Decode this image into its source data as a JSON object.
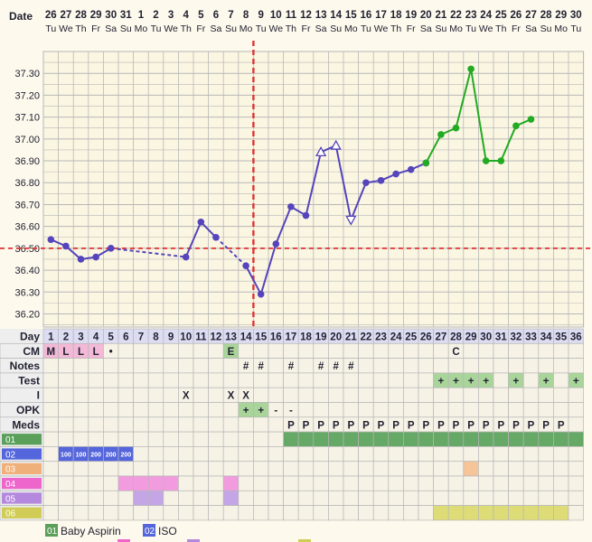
{
  "chart_data": {
    "type": "line",
    "title": "",
    "xlabel": "Day",
    "ylabel": "",
    "ylim": [
      36.14,
      37.4
    ],
    "yticks": [
      "37.30",
      "37.20",
      "37.10",
      "37.00",
      "36.90",
      "36.80",
      "36.70",
      "36.60",
      "36.50",
      "36.40",
      "36.30",
      "36.20"
    ],
    "date_label": "Date",
    "dates": [
      "26",
      "27",
      "28",
      "29",
      "30",
      "31",
      "1",
      "2",
      "3",
      "4",
      "5",
      "6",
      "7",
      "8",
      "9",
      "10",
      "11",
      "12",
      "13",
      "14",
      "15",
      "16",
      "17",
      "18",
      "19",
      "20",
      "21",
      "22",
      "23",
      "24",
      "25",
      "26",
      "27",
      "28",
      "29",
      "30"
    ],
    "weekdays": [
      "Tu",
      "We",
      "Th",
      "Fr",
      "Sa",
      "Su",
      "Mo",
      "Tu",
      "We",
      "Th",
      "Fr",
      "Sa",
      "Su",
      "Mo",
      "Tu",
      "We",
      "Th",
      "Fr",
      "Sa",
      "Su",
      "Mo",
      "Tu",
      "We",
      "Th",
      "Fr",
      "Sa",
      "Su",
      "Mo",
      "Tu",
      "We",
      "Th",
      "Fr",
      "Sa",
      "Su",
      "Mo",
      "Tu"
    ],
    "days": [
      1,
      2,
      3,
      4,
      5,
      6,
      7,
      8,
      9,
      10,
      11,
      12,
      13,
      14,
      15,
      16,
      17,
      18,
      19,
      20,
      21,
      22,
      23,
      24,
      25,
      26,
      27,
      28,
      29,
      30,
      31,
      32,
      33,
      34,
      35,
      36
    ],
    "coverline": 36.5,
    "ovulation_day": 15,
    "series": [
      {
        "name": "",
        "color": "#5544bb",
        "points": [
          [
            1,
            36.54
          ],
          [
            2,
            36.51
          ],
          [
            3,
            36.45
          ],
          [
            4,
            36.46
          ],
          [
            5,
            36.5
          ],
          [
            10,
            36.46
          ],
          [
            11,
            36.62
          ],
          [
            12,
            36.55
          ],
          [
            14,
            36.42
          ],
          [
            15,
            36.29
          ],
          [
            16,
            36.52
          ],
          [
            17,
            36.69
          ],
          [
            18,
            36.65
          ],
          [
            19,
            36.94
          ],
          [
            20,
            36.97
          ],
          [
            21,
            36.63
          ],
          [
            22,
            36.8
          ],
          [
            23,
            36.81
          ],
          [
            24,
            36.84
          ],
          [
            25,
            36.86
          ],
          [
            26,
            36.89
          ]
        ],
        "open_markers": [
          19,
          20,
          21
        ],
        "dashed_after": [
          5,
          12,
          14
        ]
      },
      {
        "name": "",
        "color": "#22aa22",
        "points": [
          [
            26,
            36.89
          ],
          [
            27,
            37.02
          ],
          [
            28,
            37.05
          ],
          [
            29,
            37.32
          ],
          [
            30,
            36.9
          ],
          [
            31,
            36.9
          ],
          [
            32,
            37.06
          ],
          [
            33,
            37.09
          ]
        ]
      }
    ],
    "rows": [
      {
        "label": "CM",
        "cells": {
          "1": "M",
          "2": "L",
          "3": "L",
          "4": "L",
          "5": "•",
          "13": "E",
          "28": "C"
        },
        "fills": {
          "1": "#f3b9d6",
          "2": "#f3b9d6",
          "3": "#f3b9d6",
          "4": "#f3b9d6",
          "13": "#a9d59a"
        }
      },
      {
        "label": "Notes",
        "cells": {
          "14": "#",
          "15": "#",
          "17": "#",
          "19": "#",
          "20": "#",
          "21": "#"
        },
        "fills": {}
      },
      {
        "label": "Test",
        "cells": {
          "27": "+",
          "28": "+",
          "29": "+",
          "30": "+",
          "32": "+",
          "34": "+",
          "36": "+"
        },
        "fills": {
          "27": "#a9d59a",
          "28": "#a9d59a",
          "29": "#a9d59a",
          "30": "#a9d59a",
          "32": "#a9d59a",
          "34": "#a9d59a",
          "36": "#a9d59a"
        }
      },
      {
        "label": "I",
        "cells": {
          "10": "X",
          "13": "X",
          "14": "X"
        },
        "fills": {}
      },
      {
        "label": "OPK",
        "cells": {
          "14": "+",
          "15": "+",
          "16": "-",
          "17": "-"
        },
        "fills": {
          "14": "#a9d59a",
          "15": "#a9d59a"
        }
      },
      {
        "label": "Meds",
        "cells": {
          "17": "P",
          "18": "P",
          "19": "P",
          "20": "P",
          "21": "P",
          "22": "P",
          "23": "P",
          "24": "P",
          "25": "P",
          "26": "P",
          "27": "P",
          "28": "P",
          "29": "P",
          "30": "P",
          "31": "P",
          "32": "P",
          "33": "P",
          "34": "P",
          "35": "P"
        },
        "fills": {}
      },
      {
        "label": "01",
        "label_color": "#5aa05a",
        "cells": {},
        "range_fill": [
          17,
          36,
          "#66a866"
        ]
      },
      {
        "label": "02",
        "label_color": "#5566dd",
        "cells": {
          "2": "100",
          "3": "100",
          "4": "200",
          "5": "200",
          "6": "200"
        },
        "fills": {
          "2": "#5566dd",
          "3": "#5566dd",
          "4": "#5566dd",
          "5": "#5566dd",
          "6": "#5566dd"
        }
      },
      {
        "label": "03",
        "label_color": "#f0b07a",
        "cells": {},
        "fills": {
          "29": "#f6c499"
        }
      },
      {
        "label": "04",
        "label_color": "#ee66cc",
        "cells": {},
        "fills": {
          "6": "#f29bdf",
          "7": "#f29bdf",
          "8": "#f29bdf",
          "9": "#f29bdf",
          "13": "#f29bdf"
        }
      },
      {
        "label": "05",
        "label_color": "#b488dd",
        "cells": {},
        "fills": {
          "7": "#c4a6e6",
          "8": "#c4a6e6",
          "13": "#c4a6e6"
        }
      },
      {
        "label": "06",
        "label_color": "#d0cc55",
        "cells": {},
        "range_fill": [
          27,
          35,
          "#dedc77"
        ]
      }
    ],
    "legend": [
      {
        "code": "01",
        "name": "Baby Aspirin",
        "color": "#5aa05a"
      },
      {
        "code": "02",
        "name": "ISO",
        "color": "#5566dd"
      }
    ],
    "legend_swatches": [
      "#ee66cc",
      "#b488dd",
      "#d0cc55"
    ]
  },
  "colors": {
    "background": "#fdf9ec",
    "grid": "#b7b7b7",
    "coverline": "#dd3333",
    "label_bg": "#eeeeee"
  }
}
